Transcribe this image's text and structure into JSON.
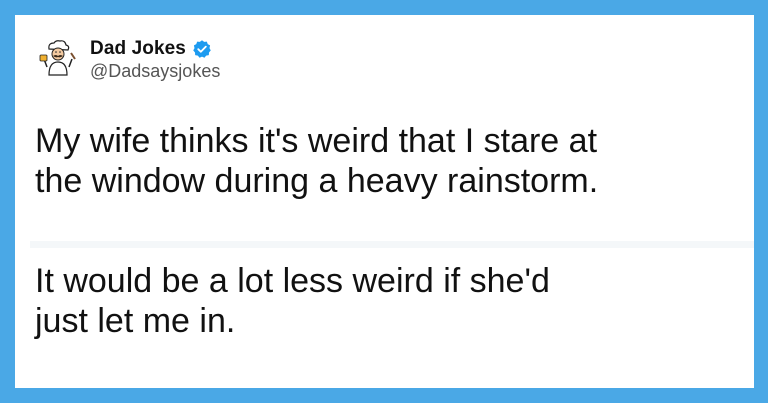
{
  "theme": {
    "frame_color": "#4aa8e6",
    "card_color": "#ffffff",
    "text_color": "#111111",
    "handle_color": "#555555",
    "verified_color": "#1d9bf0"
  },
  "tweet": {
    "display_name": "Dad Jokes",
    "handle": "@Dadsaysjokes",
    "verified_icon": "verified-badge-icon",
    "avatar_icon": "chef-cartoon-avatar",
    "paragraph_1": {
      "line_1": "My wife thinks it's weird that I stare at",
      "line_2": "the window during a heavy rainstorm."
    },
    "paragraph_2": {
      "line_1": "It would be a lot less weird if she'd",
      "line_2": "just let me in."
    }
  }
}
